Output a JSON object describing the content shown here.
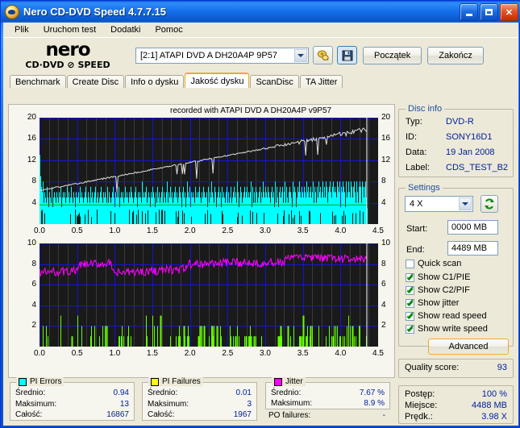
{
  "window": {
    "title": "Nero CD-DVD Speed 4.7.7.15",
    "icon": "nero-disc-icon",
    "minimize_label": "_",
    "maximize_label": "□",
    "close_label": "✕"
  },
  "menubar": {
    "items": [
      {
        "label": "Plik"
      },
      {
        "label": "Uruchom test"
      },
      {
        "label": "Dodatki"
      },
      {
        "label": "Pomoc"
      }
    ]
  },
  "toolbar": {
    "logo_line1": "nero",
    "logo_line2": "CD·DVD ⊘ SPEED",
    "drive": "[2:1]   ATAPI DVD A  DH20A4P 9P57",
    "eject_icon": "eject-disc-icon",
    "save_icon": "floppy-save-icon",
    "start_label": "Początek",
    "exit_label": "Zakończ"
  },
  "tabs": [
    {
      "label": "Benchmark",
      "active": false
    },
    {
      "label": "Create Disc",
      "active": false
    },
    {
      "label": "Info o dysku",
      "active": false
    },
    {
      "label": "Jakość dysku",
      "active": true
    },
    {
      "label": "ScanDisc",
      "active": false
    },
    {
      "label": "TA Jitter",
      "active": false
    }
  ],
  "disc_info": {
    "title": "Disc info",
    "rows": [
      {
        "key": "Typ:",
        "value": "DVD-R"
      },
      {
        "key": "ID:",
        "value": "SONY16D1"
      },
      {
        "key": "Data:",
        "value": "19 Jan 2008"
      },
      {
        "key": "Label:",
        "value": "CDS_TEST_B2"
      }
    ]
  },
  "settings": {
    "title": "Settings",
    "speed": "4 X",
    "refresh_icon": "refresh-arrows-icon",
    "start_label": "Start:",
    "start_value": "0000 MB",
    "end_label": "End:",
    "end_value": "4489 MB",
    "checkboxes": [
      {
        "label": "Quick scan",
        "checked": false
      },
      {
        "label": "Show C1/PIE",
        "checked": true
      },
      {
        "label": "Show C2/PIF",
        "checked": true
      },
      {
        "label": "Show jitter",
        "checked": true
      },
      {
        "label": "Show read speed",
        "checked": true
      },
      {
        "label": "Show write speed",
        "checked": true
      }
    ],
    "advanced_label": "Advanced"
  },
  "quality": {
    "label": "Quality score:",
    "value": "93"
  },
  "progress": {
    "rows": [
      {
        "key": "Postęp:",
        "value": "100 %"
      },
      {
        "key": "Miejsce:",
        "value": "4488 MB"
      },
      {
        "key": "Prędk.:",
        "value": "3.98 X"
      }
    ]
  },
  "stats": {
    "pi_errors": {
      "title": "PI Errors",
      "color": "#00ffff",
      "rows": [
        {
          "key": "Średnio:",
          "value": "0.94"
        },
        {
          "key": "Maksimum:",
          "value": "13"
        },
        {
          "key": "Całość:",
          "value": "16867"
        }
      ]
    },
    "pi_failures": {
      "title": "PI Failures",
      "color": "#ffff00",
      "rows": [
        {
          "key": "Średnio:",
          "value": "0.01"
        },
        {
          "key": "Maksimum:",
          "value": "3"
        },
        {
          "key": "Całość:",
          "value": "1967"
        }
      ]
    },
    "jitter": {
      "title": "Jitter",
      "color": "#ff00ff",
      "rows": [
        {
          "key": "Średnio:",
          "value": "7.67 %"
        },
        {
          "key": "Maksimum:",
          "value": "8.9 %"
        }
      ]
    },
    "po_failures": {
      "key": "PO failures:",
      "value": "-"
    }
  },
  "chart_data": [
    {
      "id": "pie-chart",
      "type": "area",
      "title": "recorded with ATAPI   DVD A  DH20A4P   v9P57",
      "xlabel": "",
      "ylabel": "",
      "xlim": [
        0,
        4.5
      ],
      "ylim": [
        0,
        20
      ],
      "xticks": [
        0.0,
        0.5,
        1.0,
        1.5,
        2.0,
        2.5,
        3.0,
        3.5,
        4.0,
        4.5
      ],
      "xticklabels": [
        "0.0",
        "0.5",
        "1.0",
        "1.5",
        "2.0",
        "2.5",
        "3.0",
        "3.5",
        "4.0",
        "4.5"
      ],
      "yticks": [
        4,
        8,
        12,
        16,
        20
      ],
      "yticklabels": [
        "4",
        "8",
        "12",
        "16",
        "20"
      ],
      "y2ticks": [
        4,
        8,
        12,
        16,
        20
      ],
      "y2ticklabels": [
        "4",
        "8",
        "12",
        "16",
        "20"
      ],
      "grid": true,
      "data_end_x": 4.35,
      "series": [
        {
          "name": "PI Errors",
          "color": "#00ffff",
          "type": "vertical-bars",
          "avg": 0.94,
          "max": 13,
          "total": 16867,
          "baseline_band": 3.2,
          "samples": [
            13,
            9,
            5,
            7,
            4,
            6,
            3,
            5,
            8,
            4,
            3,
            6,
            4,
            5,
            3,
            4,
            7,
            3,
            4,
            5,
            3,
            6,
            4,
            3,
            5,
            4,
            3,
            7,
            4,
            3,
            5,
            4,
            6,
            3,
            4,
            5,
            3,
            4,
            6,
            3,
            5,
            4,
            3,
            6,
            4,
            5,
            3,
            4,
            7,
            3,
            4,
            5,
            6,
            3,
            4,
            5,
            3,
            6,
            4,
            3,
            5,
            7,
            4,
            3,
            5,
            4,
            6,
            3,
            4,
            5,
            3,
            7,
            4,
            5,
            3,
            4,
            6,
            3,
            5,
            4,
            3,
            6,
            4,
            5,
            3,
            4,
            5,
            6,
            3,
            4,
            7,
            3,
            5,
            4,
            3,
            6,
            4,
            5,
            3,
            4,
            5,
            3,
            6,
            4,
            7,
            3,
            5,
            4,
            3,
            6,
            4,
            5,
            3,
            4,
            7,
            3,
            5,
            4,
            6,
            3,
            4,
            5,
            3,
            6,
            4,
            5,
            7,
            3,
            4,
            5,
            3,
            6,
            4,
            3,
            5,
            4,
            6,
            3,
            7,
            4,
            5,
            3,
            4,
            6,
            3,
            5,
            4,
            3,
            6,
            5,
            4,
            3,
            5,
            7,
            4,
            3,
            6,
            4,
            5,
            3,
            4,
            5,
            3,
            6,
            4,
            7,
            3,
            5,
            4,
            3,
            6,
            4,
            5,
            3,
            4,
            6,
            3,
            5,
            7,
            4,
            3,
            5,
            4,
            6,
            3,
            4,
            5,
            3,
            6,
            4,
            5,
            3,
            7,
            4,
            3,
            5,
            6,
            4,
            3,
            5,
            4,
            6,
            3,
            5,
            4,
            7,
            3,
            4,
            6,
            5,
            3,
            4,
            5,
            3,
            6,
            4,
            3,
            7,
            5,
            4,
            3,
            6,
            4,
            5,
            3,
            4,
            6,
            3,
            5,
            4,
            8,
            3,
            5,
            4,
            6,
            3,
            4,
            5,
            3,
            6,
            7,
            4,
            3,
            5,
            4,
            6,
            3,
            5,
            4,
            3,
            6,
            4,
            5,
            3,
            7,
            4,
            3,
            6,
            5,
            4,
            3,
            5,
            6,
            4,
            3,
            4,
            7,
            5,
            3,
            6,
            4,
            3,
            5,
            4,
            6,
            3,
            5,
            7,
            4,
            3,
            6,
            4,
            5,
            3,
            4,
            6,
            3,
            5,
            8,
            4,
            3,
            6,
            5,
            4,
            3,
            7,
            5,
            4,
            6,
            3,
            4,
            5,
            3,
            6,
            4,
            7,
            3,
            5,
            4,
            6,
            3,
            4,
            5,
            3,
            7,
            4,
            6,
            3,
            5,
            4,
            3,
            6,
            5,
            4,
            7,
            3,
            5,
            4,
            6,
            3,
            4,
            5,
            3,
            8,
            6,
            4,
            3,
            5,
            7,
            4,
            3,
            6,
            4,
            5,
            3,
            4,
            6,
            5,
            3,
            4,
            7,
            3,
            5,
            4,
            6,
            3,
            5,
            4,
            3,
            6,
            7,
            4,
            5,
            3,
            4,
            6,
            3,
            5,
            4,
            7,
            3,
            6,
            4,
            5,
            3,
            5,
            4,
            6,
            3,
            7,
            5,
            4,
            3,
            6,
            4,
            5,
            3,
            8,
            4,
            6,
            3,
            5,
            4,
            3,
            7,
            5,
            4,
            6,
            3,
            4,
            5,
            3,
            6,
            7,
            4,
            3,
            5,
            6,
            4,
            3,
            4,
            7,
            5,
            3,
            6,
            4,
            5,
            3,
            4,
            6,
            3,
            7,
            5,
            4,
            3,
            6,
            5,
            4,
            3,
            5,
            7,
            6,
            4,
            3,
            5,
            4,
            6,
            3,
            7,
            4,
            5,
            3,
            6,
            4,
            3,
            5,
            8,
            4,
            6,
            3,
            5,
            4,
            7,
            3,
            6,
            5,
            4,
            3,
            5,
            6,
            4,
            7,
            3,
            5,
            4,
            6,
            3,
            4,
            7,
            5,
            3,
            6,
            4,
            5,
            3,
            6,
            4,
            8,
            3,
            5,
            7,
            4,
            3,
            6,
            5,
            4,
            3,
            7,
            5,
            6,
            4,
            3,
            5,
            4,
            6,
            3,
            7,
            5,
            4,
            3,
            6,
            4,
            5,
            3,
            8,
            6,
            4,
            5,
            3,
            7,
            4,
            6,
            3,
            5,
            4,
            7,
            3,
            6,
            5,
            4,
            3,
            6,
            4,
            5,
            7,
            3,
            5,
            4,
            6,
            3,
            8,
            5,
            4,
            3,
            7,
            6,
            4,
            5,
            3,
            6,
            4,
            7,
            3,
            5,
            4,
            6,
            3,
            7,
            5,
            4,
            6,
            3,
            5,
            8,
            4,
            3,
            6,
            7,
            5,
            4,
            3,
            6,
            4,
            5,
            7,
            3,
            6,
            4,
            5,
            3,
            8,
            4,
            6,
            5,
            3,
            7,
            4,
            6,
            3,
            5,
            4,
            7,
            3,
            6,
            5,
            4,
            8,
            3,
            6,
            5,
            4,
            7,
            3,
            6,
            4,
            5,
            3,
            7,
            6,
            4,
            5,
            3,
            8,
            6,
            4,
            7,
            3,
            5,
            4,
            6,
            3,
            7,
            5,
            4,
            6,
            3,
            8,
            5,
            4,
            7,
            3,
            6,
            5,
            4,
            3,
            7,
            6,
            5,
            4,
            8,
            3,
            6,
            4,
            7,
            5,
            3,
            6,
            4,
            8,
            5,
            3,
            7,
            6,
            4,
            5,
            3,
            8,
            7,
            5,
            4,
            6,
            3,
            7,
            5,
            4,
            8,
            3,
            6,
            5,
            7,
            4,
            3,
            8,
            6,
            5,
            4,
            7,
            3,
            6,
            5,
            8,
            4,
            3,
            7,
            6,
            5,
            4,
            8,
            3,
            7,
            5,
            6,
            4,
            3,
            8,
            7,
            5,
            4,
            6,
            3,
            7,
            8,
            5,
            4,
            6,
            3,
            8,
            7,
            6,
            5,
            4,
            3,
            8,
            6,
            7,
            5,
            4,
            3,
            7,
            8,
            6,
            5,
            4,
            3,
            8,
            7,
            6,
            5,
            4,
            7,
            3,
            8,
            6,
            5,
            7,
            4,
            3,
            8,
            6,
            7,
            5,
            4,
            3,
            7,
            8,
            6,
            5,
            4,
            3
          ]
        },
        {
          "name": "Read speed",
          "color": "#e0e0e0",
          "type": "line",
          "start_value": 6.3,
          "end_value": 17.8,
          "dip_depth": 2.6
        },
        {
          "name": "Write speed",
          "color": "#00b000",
          "type": "hline",
          "value": 3.6
        }
      ]
    },
    {
      "id": "pif-jitter-chart",
      "type": "line",
      "title": "",
      "xlim": [
        0,
        4.5
      ],
      "ylim": [
        0,
        10
      ],
      "xticks": [
        0.0,
        0.5,
        1.0,
        1.5,
        2.0,
        2.5,
        3.0,
        3.5,
        4.0,
        4.5
      ],
      "xticklabels": [
        "0.0",
        "0.5",
        "1.0",
        "1.5",
        "2.0",
        "2.5",
        "3.0",
        "3.5",
        "4.0",
        "4.5"
      ],
      "yticks": [
        2,
        4,
        6,
        8,
        10
      ],
      "yticklabels": [
        "2",
        "4",
        "6",
        "8",
        "10"
      ],
      "y2ticks": [
        2,
        4,
        6,
        8,
        10
      ],
      "y2ticklabels": [
        "2",
        "4",
        "6",
        "8",
        "10"
      ],
      "grid": true,
      "data_end_x": 4.35,
      "series": [
        {
          "name": "Jitter",
          "color": "#ff00ff",
          "type": "line",
          "avg": 7.67,
          "max": 8.9,
          "baseline": 7.6
        },
        {
          "name": "PI Failures",
          "color": "#66ff00",
          "type": "vertical-bars",
          "avg": 0.01,
          "max": 3,
          "total": 1967
        }
      ]
    }
  ]
}
